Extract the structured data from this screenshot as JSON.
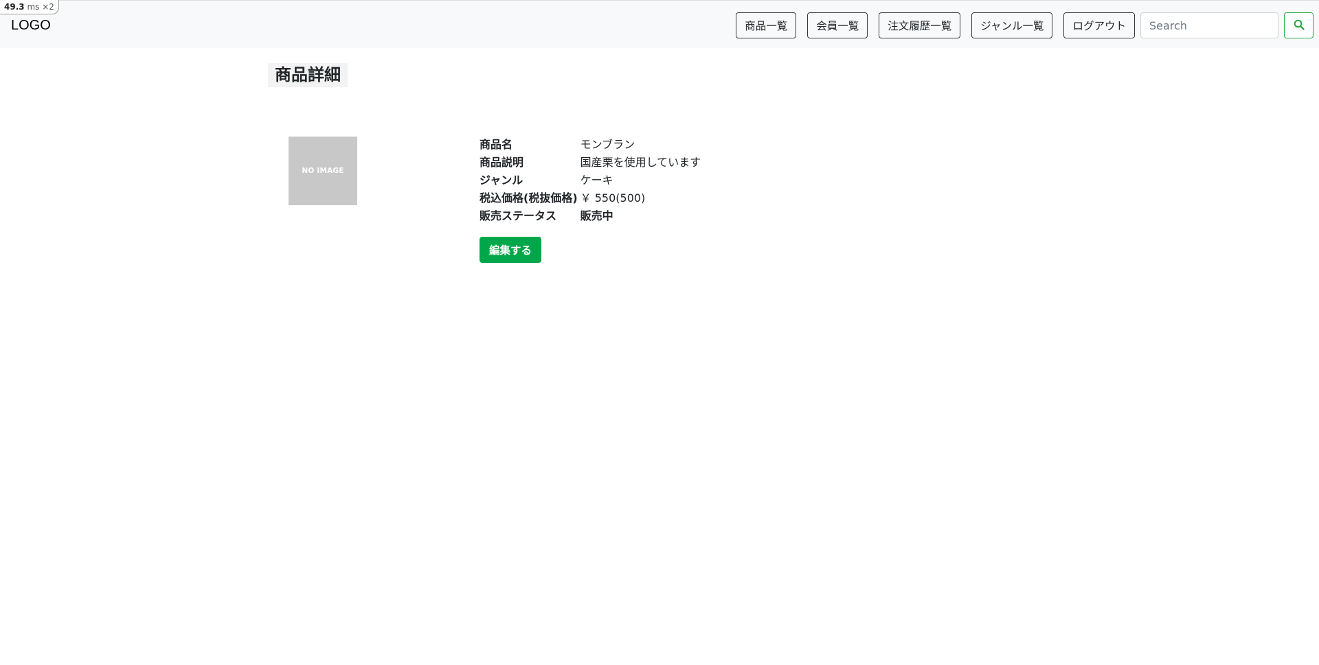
{
  "perf_badge": {
    "value": "49.3",
    "unit": "ms",
    "multiplier": "×2"
  },
  "header": {
    "logo": "LOGO",
    "nav": [
      {
        "label": "商品一覧"
      },
      {
        "label": "会員一覧"
      },
      {
        "label": "注文履歴一覧"
      },
      {
        "label": "ジャンル一覧"
      },
      {
        "label": "ログアウト"
      }
    ],
    "search": {
      "placeholder": "Search",
      "value": ""
    },
    "search_icon": "search-icon"
  },
  "main": {
    "title": "商品詳細",
    "image_placeholder": "NO IMAGE",
    "details": [
      {
        "label": "商品名",
        "value": "モンブラン"
      },
      {
        "label": "商品説明",
        "value": "国産栗を使用しています"
      },
      {
        "label": "ジャンル",
        "value": "ケーキ"
      },
      {
        "label": "税込価格(税抜価格)",
        "value": "￥ 550(500)"
      },
      {
        "label": "販売ステータス",
        "value": "販売中"
      }
    ],
    "edit_label": "編集する"
  },
  "colors": {
    "accent_green": "#28a745",
    "button_green": "#00a74a",
    "navbar_bg": "#f8f9fa",
    "image_placeholder_bg": "#c8c8c8"
  }
}
